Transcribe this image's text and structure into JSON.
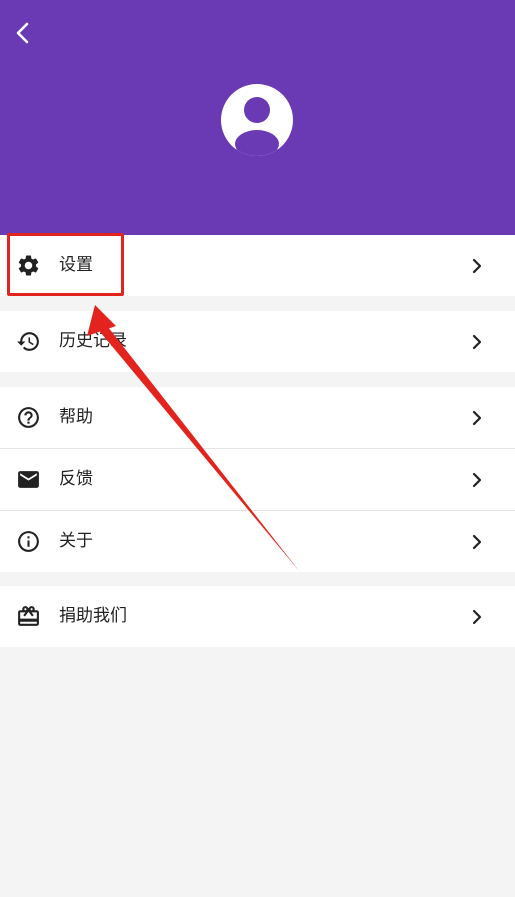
{
  "header": {
    "back_icon": "chevron-left-icon",
    "avatar_icon": "person-avatar-icon",
    "background_color": "#6a3ab4"
  },
  "menu": {
    "settings": {
      "label": "设置",
      "icon": "gear-icon"
    },
    "history": {
      "label": "历史记录",
      "icon": "history-icon"
    },
    "help": {
      "label": "帮助",
      "icon": "help-circle-icon"
    },
    "feedback": {
      "label": "反馈",
      "icon": "mail-icon"
    },
    "about": {
      "label": "关于",
      "icon": "info-icon"
    },
    "donate": {
      "label": "捐助我们",
      "icon": "gift-icon"
    }
  },
  "annotation": {
    "highlight_color": "#e3241e"
  }
}
